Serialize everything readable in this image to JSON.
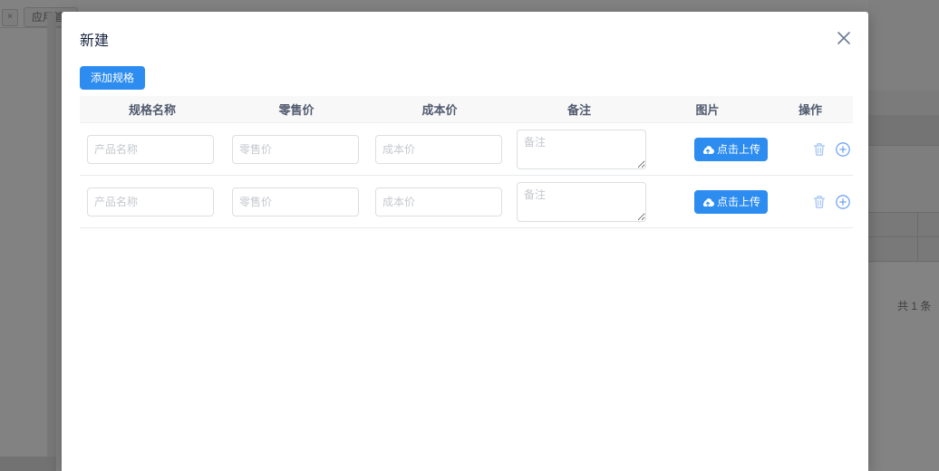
{
  "colors": {
    "primary": "#2d8cf0",
    "header_text": "#515a6e",
    "placeholder": "#c5c8ce",
    "border": "#dcdee2",
    "row_divider": "#e8eaec",
    "thead_bg": "#f8f8f9"
  },
  "background": {
    "tab_close_label": "×",
    "tab_label": "应用管",
    "total_text": "共 1 条"
  },
  "modal": {
    "title": "新建",
    "add_spec_button": "添加规格",
    "close_icon": "close-x",
    "table": {
      "headers": [
        "规格名称",
        "零售价",
        "成本价",
        "备注",
        "图片",
        "操作"
      ],
      "rows": [
        {
          "name_placeholder": "产品名称",
          "retail_placeholder": "零售价",
          "cost_placeholder": "成本价",
          "remark_placeholder": "备注",
          "upload_label": "点击上传"
        },
        {
          "name_placeholder": "产品名称",
          "retail_placeholder": "零售价",
          "cost_placeholder": "成本价",
          "remark_placeholder": "备注",
          "upload_label": "点击上传"
        }
      ]
    }
  }
}
